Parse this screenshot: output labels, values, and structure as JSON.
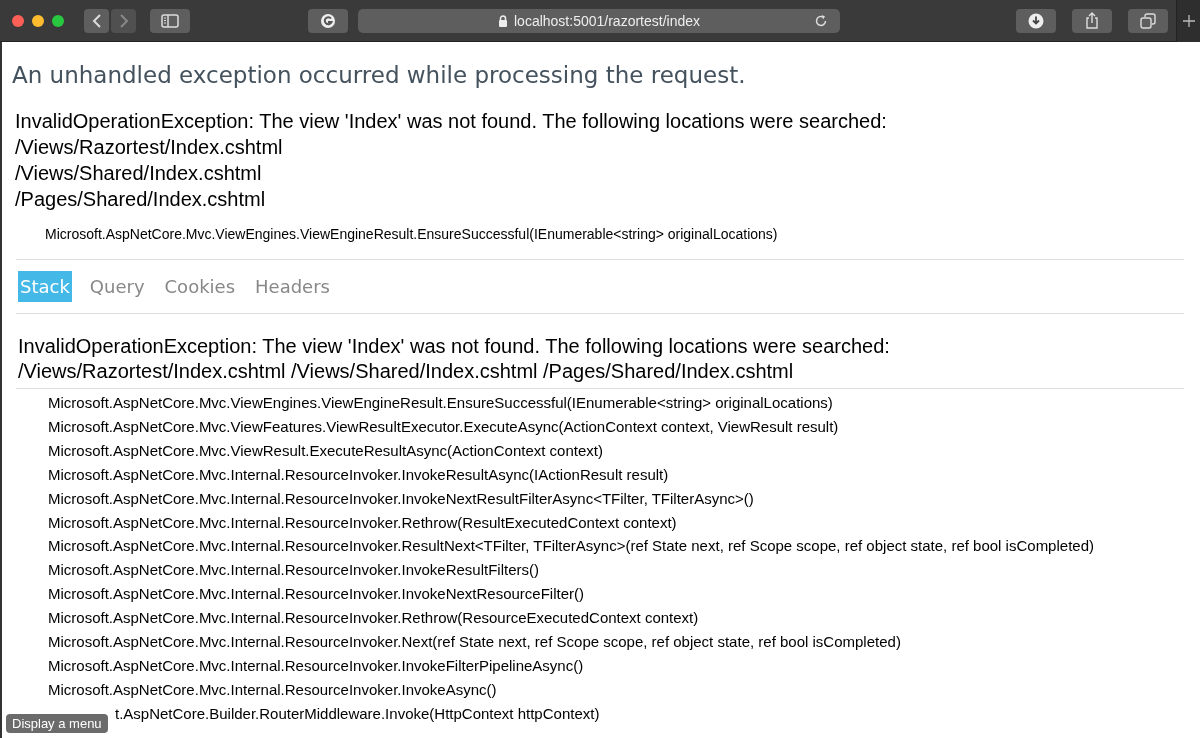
{
  "browser": {
    "address": "localhost:5001/razortest/index"
  },
  "title": "An unhandled exception occurred while processing the request.",
  "error": {
    "message": "InvalidOperationException: The view 'Index' was not found. The following locations were searched:",
    "locations": [
      "/Views/Razortest/Index.cshtml",
      "/Views/Shared/Index.cshtml",
      "/Pages/Shared/Index.cshtml"
    ],
    "source": "Microsoft.AspNetCore.Mvc.ViewEngines.ViewEngineResult.EnsureSuccessful(IEnumerable<string> originalLocations)"
  },
  "tabs": [
    {
      "label": "Stack",
      "selected": true
    },
    {
      "label": "Query",
      "selected": false
    },
    {
      "label": "Cookies",
      "selected": false
    },
    {
      "label": "Headers",
      "selected": false
    }
  ],
  "stack": {
    "heading": "InvalidOperationException: The view 'Index' was not found. The following locations were searched: /Views/Razortest/Index.cshtml /Views/Shared/Index.cshtml /Pages/Shared/Index.cshtml",
    "frames": [
      "Microsoft.AspNetCore.Mvc.ViewEngines.ViewEngineResult.EnsureSuccessful(IEnumerable<string> originalLocations)",
      "Microsoft.AspNetCore.Mvc.ViewFeatures.ViewResultExecutor.ExecuteAsync(ActionContext context, ViewResult result)",
      "Microsoft.AspNetCore.Mvc.ViewResult.ExecuteResultAsync(ActionContext context)",
      "Microsoft.AspNetCore.Mvc.Internal.ResourceInvoker.InvokeResultAsync(IActionResult result)",
      "Microsoft.AspNetCore.Mvc.Internal.ResourceInvoker.InvokeNextResultFilterAsync<TFilter, TFilterAsync>()",
      "Microsoft.AspNetCore.Mvc.Internal.ResourceInvoker.Rethrow(ResultExecutedContext context)",
      "Microsoft.AspNetCore.Mvc.Internal.ResourceInvoker.ResultNext<TFilter, TFilterAsync>(ref State next, ref Scope scope, ref object state, ref bool isCompleted)",
      "Microsoft.AspNetCore.Mvc.Internal.ResourceInvoker.InvokeResultFilters()",
      "Microsoft.AspNetCore.Mvc.Internal.ResourceInvoker.InvokeNextResourceFilter()",
      "Microsoft.AspNetCore.Mvc.Internal.ResourceInvoker.Rethrow(ResourceExecutedContext context)",
      "Microsoft.AspNetCore.Mvc.Internal.ResourceInvoker.Next(ref State next, ref Scope scope, ref object state, ref bool isCompleted)",
      "Microsoft.AspNetCore.Mvc.Internal.ResourceInvoker.InvokeFilterPipelineAsync()",
      "Microsoft.AspNetCore.Mvc.Internal.ResourceInvoker.InvokeAsync()"
    ],
    "covered_frame": "t.AspNetCore.Builder.RouterMiddleware.Invoke(HttpContext httpContext)"
  },
  "tooltip": "Display a menu"
}
